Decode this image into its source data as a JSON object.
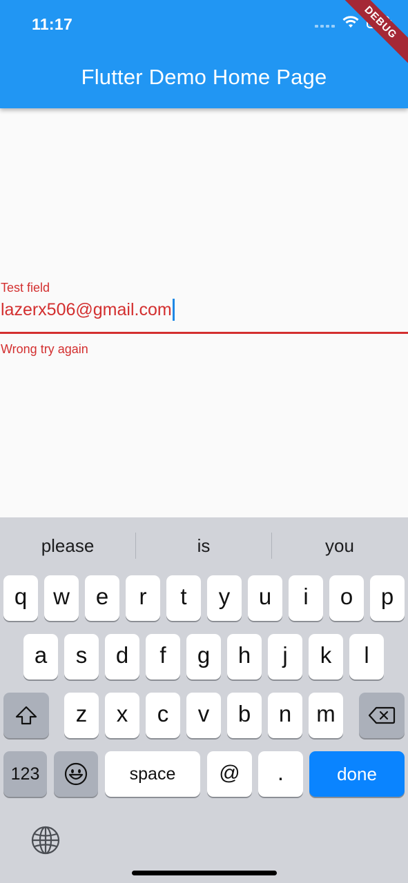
{
  "status_bar": {
    "time": "11:17"
  },
  "app_bar": {
    "title": "Flutter Demo Home Page",
    "debug_banner": "DEBUG"
  },
  "text_field": {
    "label": "Test field",
    "value": "lazerx506@gmail.com",
    "error": "Wrong try again",
    "error_color": "#d32f2f"
  },
  "keyboard": {
    "suggestions": [
      "please",
      "is",
      "you"
    ],
    "row1": [
      "q",
      "w",
      "e",
      "r",
      "t",
      "y",
      "u",
      "i",
      "o",
      "p"
    ],
    "row2": [
      "a",
      "s",
      "d",
      "f",
      "g",
      "h",
      "j",
      "k",
      "l"
    ],
    "row3": [
      "z",
      "x",
      "c",
      "v",
      "b",
      "n",
      "m"
    ],
    "numbers_label": "123",
    "space_label": "space",
    "at_label": "@",
    "dot_label": ".",
    "done_label": "done",
    "icons": [
      "shift-icon",
      "backspace-icon",
      "emoji-icon",
      "globe-icon"
    ],
    "done_color": "#0a84ff"
  },
  "colors": {
    "app_bar": "#2196f3",
    "background": "#fafafa",
    "keyboard": "#d1d3d9"
  }
}
